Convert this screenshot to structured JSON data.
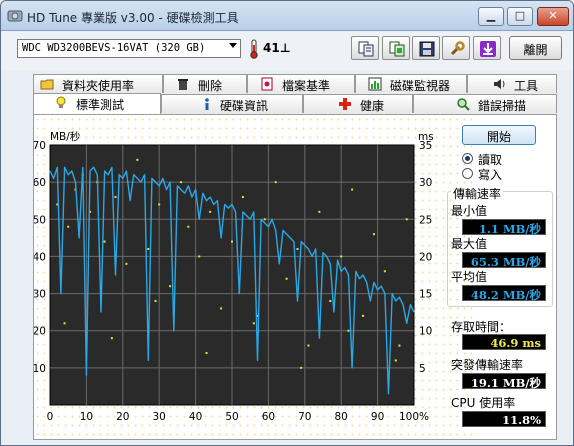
{
  "window": {
    "title": "HD Tune 專業版 v3.00 - 硬碟檢測工具"
  },
  "toolbar": {
    "drive": "WDC WD3200BEVS-16VAT (320 GB)",
    "temperature": "41",
    "temperature_unit": "⊥",
    "exit_label": "離開"
  },
  "tabs_top": [
    {
      "label": "資料夾使用率",
      "icon": "folder-icon"
    },
    {
      "label": "刪除",
      "icon": "trash-icon"
    },
    {
      "label": "檔案基準",
      "icon": "file-benchmark-icon"
    },
    {
      "label": "磁碟監視器",
      "icon": "disk-monitor-icon"
    },
    {
      "label": "工具",
      "icon": "speaker-icon"
    }
  ],
  "tabs_bottom": [
    {
      "label": "標準測試",
      "icon": "lightbulb-icon",
      "active": true
    },
    {
      "label": "硬碟資訊",
      "icon": "info-icon"
    },
    {
      "label": "健康",
      "icon": "health-cross-icon"
    },
    {
      "label": "錯誤掃描",
      "icon": "magnifier-icon"
    }
  ],
  "controls": {
    "start_label": "開始",
    "read_label": "讀取",
    "write_label": "寫入",
    "selected_mode": "read"
  },
  "results": {
    "transfer_rate_title": "傳輸速率",
    "min_label": "最小值",
    "min_value": "1.1 MB/秒",
    "max_label": "最大值",
    "max_value": "65.3 MB/秒",
    "avg_label": "平均值",
    "avg_value": "48.2 MB/秒",
    "access_time_label": "存取時間：",
    "access_time_value": "46.9 ms",
    "burst_rate_label": "突發傳輸速率",
    "burst_rate_value": "19.1 MB/秒",
    "cpu_label": "CPU 使用率",
    "cpu_value": "11.8%"
  },
  "colors": {
    "chart_bg": "#2a2a2a",
    "grid": "#6a6a6a",
    "transfer_line": "#2aa8e6",
    "access_points": "#e8e040",
    "value_blue": "#2aa8e6",
    "value_yellow": "#f4ec48"
  },
  "chart_data": {
    "type": "line",
    "ylabel_left": "MB/秒",
    "ylabel_right": "ms",
    "ylim_left": [
      0,
      70
    ],
    "ylim_right": [
      0,
      35
    ],
    "xlim": [
      0,
      100
    ],
    "x_ticks": [
      "0",
      "10",
      "20",
      "30",
      "40",
      "50",
      "60",
      "70",
      "80",
      "90",
      "100%"
    ],
    "y_ticks_left": [
      "70",
      "60",
      "50",
      "40",
      "30",
      "20",
      "10"
    ],
    "y_ticks_right": [
      "35",
      "30",
      "25",
      "20",
      "15",
      "10",
      "5"
    ],
    "grid": true,
    "series": [
      {
        "x": [
          0,
          1,
          2,
          3,
          4,
          5,
          6,
          7,
          8,
          9,
          10,
          11,
          12,
          13,
          14,
          15,
          16,
          17,
          18,
          19,
          20,
          21,
          22,
          23,
          24,
          25,
          26,
          27,
          28,
          29,
          30,
          31,
          32,
          33,
          34,
          35,
          36,
          37,
          38,
          39,
          40,
          41,
          42,
          43,
          44,
          45,
          46,
          47,
          48,
          49,
          50,
          51,
          52,
          53,
          54,
          55,
          56,
          57,
          58,
          59,
          60,
          61,
          62,
          63,
          64,
          65,
          66,
          67,
          68,
          69,
          70,
          71,
          72,
          73,
          74,
          75,
          76,
          77,
          78,
          79,
          80,
          81,
          82,
          83,
          84,
          85,
          86,
          87,
          88,
          89,
          90,
          91,
          92,
          93,
          94,
          95,
          96,
          97,
          98,
          99,
          100
        ],
        "values": [
          63,
          61,
          64,
          30,
          64,
          62,
          63,
          60,
          45,
          64,
          8,
          63,
          64,
          62,
          25,
          63,
          62,
          64,
          35,
          62,
          61,
          63,
          55,
          62,
          61,
          60,
          62,
          12,
          61,
          60,
          59,
          61,
          58,
          60,
          20,
          59,
          58,
          57,
          59,
          56,
          58,
          50,
          57,
          55,
          56,
          54,
          55,
          45,
          54,
          53,
          54,
          52,
          30,
          52,
          51,
          50,
          52,
          12,
          50,
          49,
          48,
          50,
          47,
          38,
          47,
          46,
          45,
          44,
          28,
          44,
          43,
          42,
          40,
          42,
          18,
          41,
          40,
          38,
          25,
          39,
          36,
          37,
          35,
          10,
          36,
          34,
          35,
          33,
          28,
          33,
          31,
          32,
          30,
          3,
          30,
          28,
          29,
          27,
          22,
          27,
          25
        ]
      },
      {
        "x": [
          2,
          5,
          7,
          9,
          11,
          13,
          15,
          18,
          21,
          24,
          27,
          30,
          33,
          36,
          38,
          41,
          44,
          47,
          50,
          53,
          56,
          59,
          62,
          65,
          68,
          71,
          74,
          77,
          80,
          83,
          86,
          89,
          92,
          95,
          98,
          4,
          17,
          29,
          43,
          57,
          69,
          82,
          96
        ],
        "values": [
          27,
          24,
          29,
          31,
          26,
          30,
          22,
          28,
          19,
          33,
          21,
          27,
          16,
          30,
          24,
          20,
          26,
          13,
          22,
          28,
          11,
          25,
          30,
          17,
          21,
          8,
          26,
          14,
          20,
          29,
          12,
          23,
          18,
          6,
          25,
          11,
          9,
          14,
          7,
          12,
          5,
          10,
          8
        ]
      }
    ]
  }
}
